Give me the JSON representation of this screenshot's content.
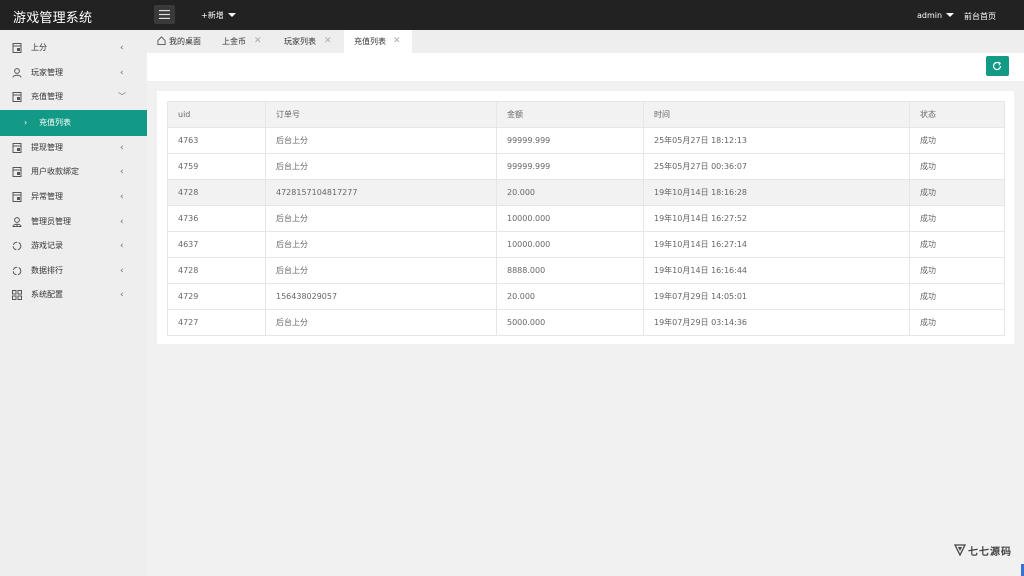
{
  "header": {
    "app_title": "游戏管理系统",
    "new_label": "+新增",
    "user": "admin",
    "front_link": "前台首页"
  },
  "sidebar": {
    "items": [
      {
        "label": "上分",
        "icon": "document-icon"
      },
      {
        "label": "玩家管理",
        "icon": "user-icon"
      },
      {
        "label": "充值管理",
        "icon": "document-icon",
        "expanded": true
      },
      {
        "label": "提现管理",
        "icon": "document-icon"
      },
      {
        "label": "用户收款绑定",
        "icon": "document-icon"
      },
      {
        "label": "异常管理",
        "icon": "document-icon"
      },
      {
        "label": "管理员管理",
        "icon": "admin-user-icon"
      },
      {
        "label": "游戏记录",
        "icon": "refresh-cycle-icon"
      },
      {
        "label": "数据排行",
        "icon": "refresh-cycle-icon"
      },
      {
        "label": "系统配置",
        "icon": "grid-icon"
      }
    ],
    "sub_active": "充值列表"
  },
  "tabs": {
    "home": "我的桌面",
    "items": [
      "上金币",
      "玩家列表",
      "充值列表"
    ],
    "active": "充值列表"
  },
  "table": {
    "headers": [
      "uid",
      "订单号",
      "金额",
      "时间",
      "状态"
    ],
    "rows": [
      [
        "4763",
        "后台上分",
        "99999.999",
        "25年05月27日 18:12:13",
        "成功"
      ],
      [
        "4759",
        "后台上分",
        "99999.999",
        "25年05月27日 00:36:07",
        "成功"
      ],
      [
        "4728",
        "4728157104817277",
        "20.000",
        "19年10月14日 18:16:28",
        "成功"
      ],
      [
        "4736",
        "后台上分",
        "10000.000",
        "19年10月14日 16:27:52",
        "成功"
      ],
      [
        "4637",
        "后台上分",
        "10000.000",
        "19年10月14日 16:27:14",
        "成功"
      ],
      [
        "4728",
        "后台上分",
        "8888.000",
        "19年10月14日 16:16:44",
        "成功"
      ],
      [
        "4729",
        "156438029057",
        "20.000",
        "19年07月29日 14:05:01",
        "成功"
      ],
      [
        "4727",
        "后台上分",
        "5000.000",
        "19年07月29日 03:14:36",
        "成功"
      ]
    ]
  },
  "watermark": {
    "brand": "七七源码"
  },
  "colors": {
    "accent": "#129a86",
    "topbar": "#222222",
    "sidebar_bg": "#eeeeee"
  }
}
